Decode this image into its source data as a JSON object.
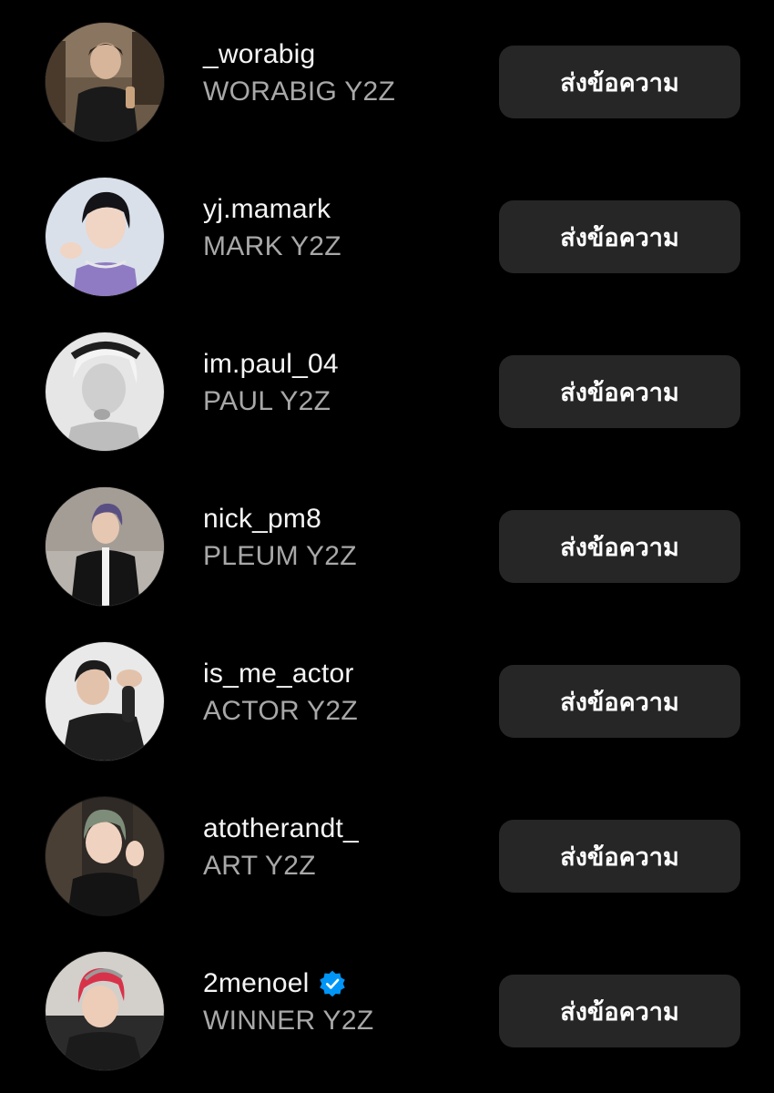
{
  "accounts": [
    {
      "username": "_worabig",
      "full_name": "WORABIG Y2Z",
      "button_label": "ส่งข้อความ",
      "verified": false,
      "avatar_icon": "profile-photo"
    },
    {
      "username": "yj.mamark",
      "full_name": "MARK Y2Z",
      "button_label": "ส่งข้อความ",
      "verified": false,
      "avatar_icon": "profile-photo"
    },
    {
      "username": "im.paul_04",
      "full_name": "PAUL Y2Z",
      "button_label": "ส่งข้อความ",
      "verified": false,
      "avatar_icon": "profile-photo"
    },
    {
      "username": "nick_pm8",
      "full_name": "PLEUM Y2Z",
      "button_label": "ส่งข้อความ",
      "verified": false,
      "avatar_icon": "profile-photo"
    },
    {
      "username": "is_me_actor",
      "full_name": "ACTOR Y2Z",
      "button_label": "ส่งข้อความ",
      "verified": false,
      "avatar_icon": "profile-photo"
    },
    {
      "username": "atotherandt_",
      "full_name": "ART Y2Z",
      "button_label": "ส่งข้อความ",
      "verified": false,
      "avatar_icon": "profile-photo"
    },
    {
      "username": "2menoel",
      "full_name": "WINNER Y2Z",
      "button_label": "ส่งข้อความ",
      "verified": true,
      "avatar_icon": "profile-photo"
    }
  ],
  "colors": {
    "background": "#000000",
    "button_bg": "#262626",
    "secondary_text": "#a8a8a8",
    "verified_badge": "#0095f6"
  }
}
